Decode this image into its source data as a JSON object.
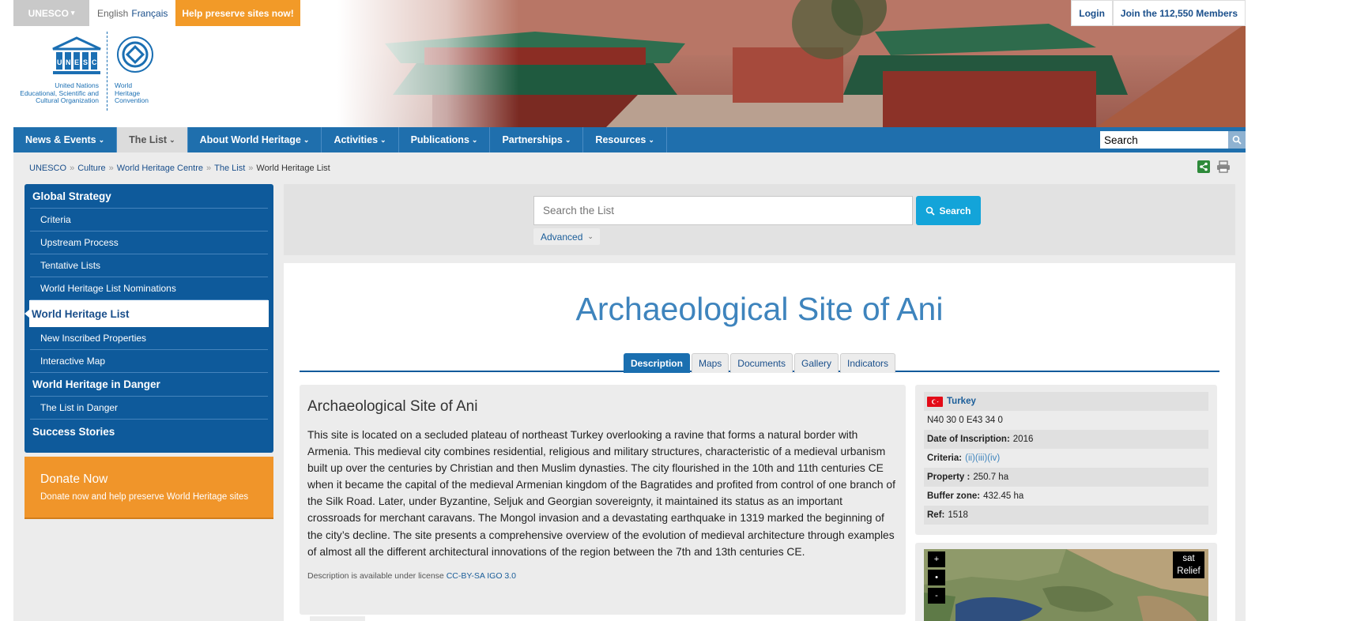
{
  "topbar": {
    "unesco_label": "UNESCO",
    "lang_english": "English",
    "lang_french": "Français",
    "help_button": "Help preserve sites now!",
    "login": "Login",
    "join": "Join the 112,550 Members"
  },
  "logos": {
    "unesco_text": "United Nations\nEducational, Scientific and\nCultural Organization",
    "whc_text": "World\nHeritage\nConvention"
  },
  "nav": {
    "items": [
      "News & Events",
      "The List",
      "About World Heritage",
      "Activities",
      "Publications",
      "Partnerships",
      "Resources"
    ],
    "search_value": "Search"
  },
  "breadcrumb": [
    "UNESCO",
    "Culture",
    "World Heritage Centre",
    "The List",
    "World Heritage List"
  ],
  "sidebar": {
    "items": [
      {
        "label": "Global Strategy"
      },
      {
        "label": "Criteria"
      },
      {
        "label": "Upstream Process"
      },
      {
        "label": "Tentative Lists"
      },
      {
        "label": "World Heritage List Nominations"
      },
      {
        "label": "World Heritage List"
      },
      {
        "label": "New Inscribed Properties"
      },
      {
        "label": "Interactive Map"
      },
      {
        "label": "World Heritage in Danger"
      },
      {
        "label": "The List in Danger"
      },
      {
        "label": "Success Stories"
      }
    ]
  },
  "donate": {
    "title": "Donate Now",
    "text": "Donate now and help preserve World Heritage sites"
  },
  "list_search": {
    "placeholder": "Search the List",
    "button": "Search",
    "advanced": "Advanced"
  },
  "site": {
    "title": "Archaeological Site of Ani",
    "tabs": [
      "Description",
      "Maps",
      "Documents",
      "Gallery",
      "Indicators"
    ],
    "description_title": "Archaeological Site of Ani",
    "description": "This site is located on a secluded plateau of northeast Turkey overlooking a ravine that forms a natural border with Armenia. This medieval city combines residential, religious and military structures, characteristic of a medieval urbanism built up over the centuries by Christian and then Muslim dynasties. The city flourished in the 10th and 11th centuries CE when it became the capital of the medieval Armenian kingdom of the Bagratides and profited from control of one branch of the Silk Road. Later, under Byzantine, Seljuk and Georgian sovereignty, it maintained its status as an important crossroads for merchant caravans. The Mongol invasion and a devastating earthquake in 1319 marked the beginning of the city’s decline. The site presents a comprehensive overview of the evolution of medieval architecture through examples of almost all the different architectural innovations of the region between the 7th and 13th centuries CE.",
    "license_prefix": "Description is available under license",
    "license_link": "CC-BY-SA IGO 3.0"
  },
  "info": {
    "country": "Turkey",
    "coordinates": "N40 30 0 E43 34 0",
    "inscription_label": "Date of Inscription:",
    "inscription_value": "2016",
    "criteria_label": "Criteria:",
    "criteria_value": "(ii)(iii)(iv)",
    "property_label": "Property :",
    "property_value": "250.7 ha",
    "buffer_label": "Buffer zone:",
    "buffer_value": "432.45 ha",
    "ref_label": "Ref:",
    "ref_value": "1518"
  },
  "map": {
    "zoom_in": "+",
    "center": "•",
    "zoom_out": "-",
    "layer_sat": "sat",
    "layer_relief": "Relief"
  },
  "colors": {
    "nav_blue": "#1f6fad",
    "sidebar_blue": "#0e5a9b",
    "orange": "#f0952a",
    "title_blue": "#3e84bd",
    "search_button": "#13a4d9"
  }
}
